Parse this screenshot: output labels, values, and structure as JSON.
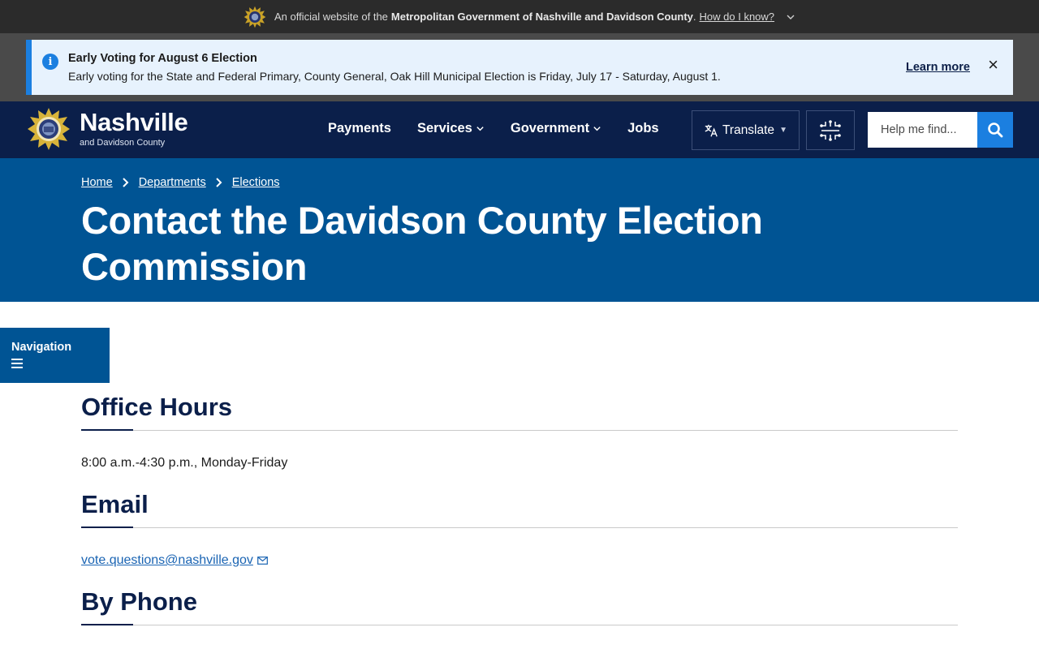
{
  "official_banner": {
    "prefix": "An official website of the",
    "org": "Metropolitan Government of Nashville and Davidson County",
    "period": ".",
    "how_link": "How do I know?"
  },
  "alert": {
    "title": "Early Voting for August 6 Election",
    "body": "Early voting for the State and Federal Primary, County General, Oak Hill Municipal Election is Friday, July 17 - Saturday, August 1.",
    "learn_more": "Learn more",
    "close": "×",
    "info_glyph": "i"
  },
  "header": {
    "brand_name": "Nashville",
    "brand_sub": "and Davidson County",
    "nav": [
      {
        "label": "Payments"
      },
      {
        "label": "Services"
      },
      {
        "label": "Government"
      },
      {
        "label": "Jobs"
      }
    ],
    "translate_label": "Translate",
    "search_placeholder": "Help me find..."
  },
  "hero": {
    "breadcrumb": [
      {
        "label": "Home"
      },
      {
        "label": "Departments"
      },
      {
        "label": "Elections"
      }
    ],
    "title": "Contact the Davidson County Election Commission"
  },
  "side_nav": {
    "label": "Navigation"
  },
  "content": {
    "office_hours": {
      "heading": "Office Hours",
      "text": "8:00 a.m.-4:30 p.m., Monday-Friday"
    },
    "email": {
      "heading": "Email",
      "address": "vote.questions@nashville.gov"
    },
    "phone": {
      "heading": "By Phone"
    }
  },
  "colors": {
    "header_bg": "#0b1f4a",
    "hero_bg": "#005494",
    "accent_blue": "#1b7fe0",
    "alert_bg": "#e7f2fd"
  },
  "icons": {
    "seal": "city-seal-icon",
    "info": "info-icon",
    "close": "close-icon",
    "translate": "translate-icon",
    "ai": "circuit-icon",
    "search": "search-icon",
    "menu": "hamburger-icon",
    "email": "mail-icon"
  }
}
